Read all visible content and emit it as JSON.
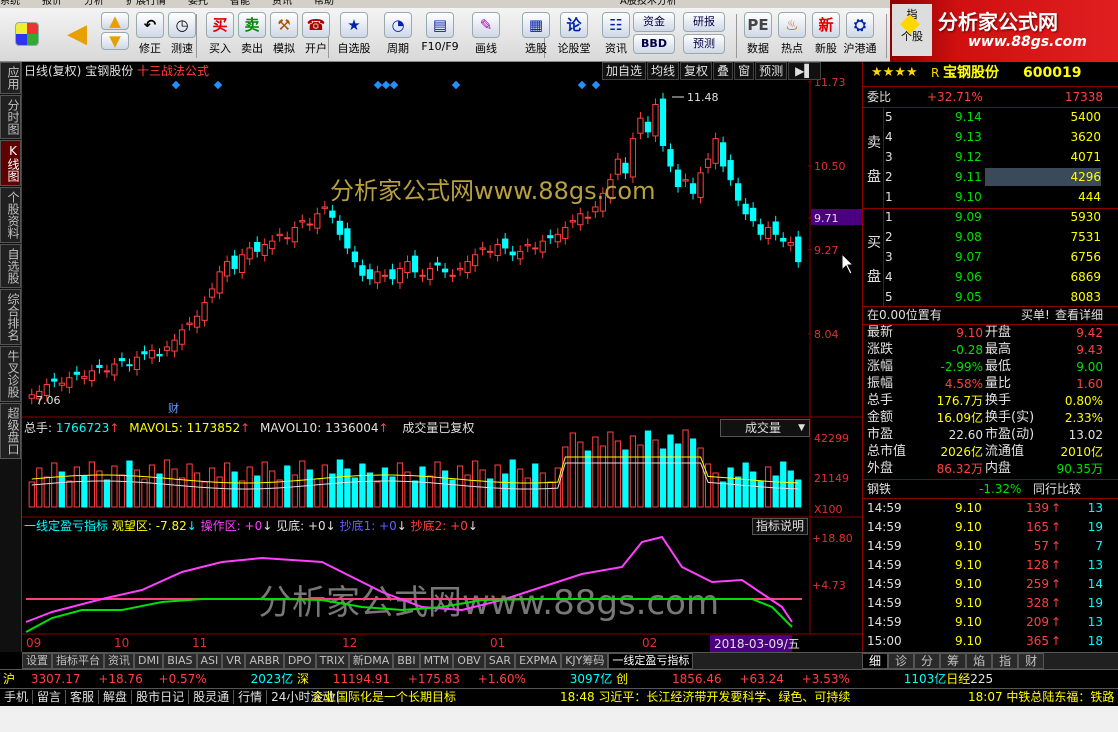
{
  "menu": [
    "系统",
    "报价",
    "分析",
    "扩展行情",
    "委托",
    "智能",
    "资讯",
    "帮助"
  ],
  "menu_title": "A股技术分析",
  "toolbar": [
    {
      "label": "修正",
      "icon": "undo-icon"
    },
    {
      "label": "测速",
      "icon": "clock-icon"
    },
    {
      "label": "买入",
      "icon": "buy-icon"
    },
    {
      "label": "卖出",
      "icon": "sell-icon"
    },
    {
      "label": "模拟",
      "icon": "hammer-icon"
    },
    {
      "label": "开户",
      "icon": "account-icon"
    },
    {
      "label": "自选股",
      "icon": "star-icon"
    },
    {
      "label": "周期",
      "icon": "period-icon"
    },
    {
      "label": "F10/F9",
      "icon": "f10-icon"
    },
    {
      "label": "画线",
      "icon": "pen-icon"
    },
    {
      "label": "选股",
      "icon": "filter-icon"
    },
    {
      "label": "论股堂",
      "icon": "forum-icon"
    },
    {
      "label": "资讯",
      "icon": "news-icon"
    },
    {
      "label": "数据",
      "icon": "pe-icon"
    },
    {
      "label": "热点",
      "icon": "hot-icon"
    },
    {
      "label": "新股",
      "icon": "new-icon"
    },
    {
      "label": "沪港通",
      "icon": "sse-icon"
    }
  ],
  "toolbar_small": {
    "fund": "资金",
    "research": "研报",
    "bbd": "BBD",
    "forecast": "预测",
    "idx": "指",
    "personal": "个股"
  },
  "brand": {
    "name": "分析家公式网",
    "url": "www.88gs.com"
  },
  "left_tabs": [
    "应用",
    "分时图",
    "K线图",
    "个股资料",
    "自选股",
    "综合排名",
    "牛叉诊股",
    "超级盘口"
  ],
  "chart_header": {
    "period": "日线(复权)",
    "stock": "宝钢股份",
    "formula": "十三战法公式"
  },
  "chart_buttons": [
    "加自选",
    "均线",
    "复权",
    "叠",
    "窗",
    "预测"
  ],
  "price_axis": [
    "11.73",
    "10.50",
    "9.71",
    "9.27",
    "8.04"
  ],
  "price_labels": {
    "high": "11.48",
    "low": "7.06",
    "fin": "财"
  },
  "vol_header": {
    "total_label": "总手:",
    "total": "1766723",
    "mavol5_label": "MAVOL5:",
    "mavol5": "1173852",
    "mavol10_label": "MAVOL10:",
    "mavol10": "1336004",
    "note": "成交量已复权",
    "select": "成交量"
  },
  "vol_axis": [
    "42299",
    "21149",
    "X100"
  ],
  "ind_header": {
    "name": "一线定盈亏指标",
    "items": [
      "观望区: -7.82",
      "操作区: +0",
      "见底: +0",
      "抄底1: +0",
      "抄底2: +0"
    ],
    "btn": "指标说明"
  },
  "ind_axis": [
    "+18.80",
    "+4.73"
  ],
  "date_axis": [
    "09",
    "10",
    "11",
    "12",
    "01",
    "02"
  ],
  "current_date": "2018-03-09/五",
  "watermark": "分析家公式网www.88gs.com",
  "quote": {
    "stars": "★★★★",
    "r": "R",
    "name": "宝钢股份",
    "code": "600019",
    "weibi_label": "委比",
    "weibi": "+32.71%",
    "weicha": "17338",
    "sell_label": [
      "卖",
      "盘"
    ],
    "buy_label": [
      "买",
      "盘"
    ],
    "sell": [
      [
        "5",
        "9.14",
        "5400"
      ],
      [
        "4",
        "9.13",
        "3620"
      ],
      [
        "3",
        "9.12",
        "4071"
      ],
      [
        "2",
        "9.11",
        "4296"
      ],
      [
        "1",
        "9.10",
        "444"
      ]
    ],
    "buy": [
      [
        "1",
        "9.09",
        "5930"
      ],
      [
        "2",
        "9.08",
        "7531"
      ],
      [
        "3",
        "9.07",
        "6756"
      ],
      [
        "4",
        "9.06",
        "6869"
      ],
      [
        "5",
        "9.05",
        "8083"
      ]
    ],
    "pos_text": "在0.00位置有",
    "buy_text": "买单!",
    "detail_text": "查看详细",
    "stats": [
      [
        "最新",
        "9.10",
        "开盘",
        "9.42"
      ],
      [
        "涨跌",
        "-0.28",
        "最高",
        "9.43"
      ],
      [
        "涨幅",
        "-2.99%",
        "最低",
        "9.00"
      ],
      [
        "振幅",
        "4.58%",
        "量比",
        "1.60"
      ],
      [
        "总手",
        "176.7万",
        "换手",
        "0.80%"
      ],
      [
        "金额",
        "16.09亿",
        "换手(实)",
        "2.33%"
      ],
      [
        "市盈",
        "22.60",
        "市盈(动)",
        "13.02"
      ],
      [
        "总市值",
        "2026亿",
        "流通值",
        "2010亿"
      ],
      [
        "外盘",
        "86.32万",
        "内盘",
        "90.35万"
      ]
    ],
    "sector": "钢铁",
    "sector_chg": "-1.32%",
    "sector_btn": "同行比较",
    "ticks": [
      [
        "14:59",
        "9.10",
        "139",
        "13"
      ],
      [
        "14:59",
        "9.10",
        "165",
        "19"
      ],
      [
        "14:59",
        "9.10",
        "57",
        "7"
      ],
      [
        "14:59",
        "9.10",
        "128",
        "13"
      ],
      [
        "14:59",
        "9.10",
        "259",
        "14"
      ],
      [
        "14:59",
        "9.10",
        "328",
        "19"
      ],
      [
        "14:59",
        "9.10",
        "209",
        "13"
      ],
      [
        "15:00",
        "9.10",
        "365",
        "18"
      ]
    ]
  },
  "bottom_tabs": [
    "设置",
    "指标平台",
    "资讯",
    "DMI",
    "BIAS",
    "ASI",
    "VR",
    "ARBR",
    "DPO",
    "TRIX",
    "新DMA",
    "BBI",
    "MTM",
    "OBV",
    "SAR",
    "EXPMA",
    "KJY筹码",
    "一线定盈亏指标"
  ],
  "right_tabs": [
    "细",
    "诊",
    "分",
    "筹",
    "焰",
    "指",
    "财"
  ],
  "indexbar": {
    "sh": "沪",
    "sh_val": "3307.17",
    "sh_chg": "+18.76",
    "sh_pct": "+0.57%",
    "sh_amt": "2023亿",
    "sz": "深",
    "sz_val": "11194.91",
    "sz_chg": "+175.83",
    "sz_pct": "+1.60%",
    "sz_amt": "3097亿",
    "cy": "创",
    "cy_val": "1856.46",
    "cy_chg": "+63.24",
    "cy_pct": "+3.53%",
    "cy_amt": "1103亿",
    "rj": "日经",
    "rj_val": "225"
  },
  "newsbar": {
    "tabs": [
      "手机",
      "留言",
      "客服",
      "解盘",
      "股市日记",
      "股灵通",
      "行情",
      "24小时滚动"
    ],
    "n1": "企业国际化是一个长期目标",
    "n2": "18:48 习近平：长江经济带开发要科学、绿色、可持续",
    "n3": "18:07 中铁总陆东福：铁路"
  },
  "colors": {
    "up": "#ff4040",
    "down": "#00ffff",
    "bg": "#000000"
  }
}
